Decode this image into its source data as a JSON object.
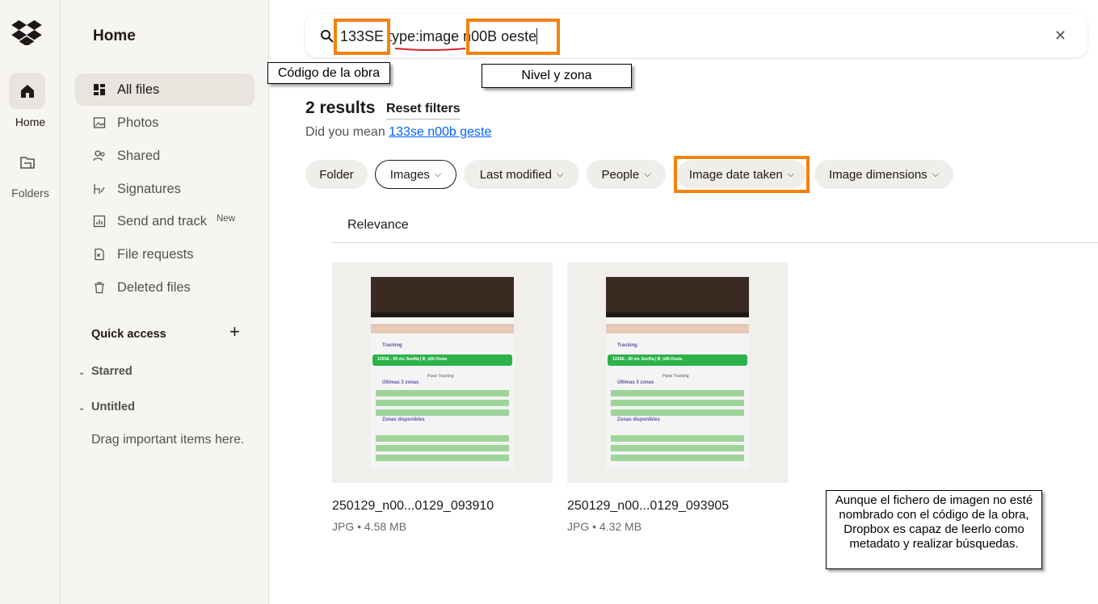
{
  "rail": {
    "home_label": "Home",
    "folders_label": "Folders"
  },
  "nav": {
    "title": "Home",
    "items": [
      {
        "label": "All files",
        "icon": "all-files-icon"
      },
      {
        "label": "Photos",
        "icon": "photos-icon"
      },
      {
        "label": "Shared",
        "icon": "shared-icon"
      },
      {
        "label": "Signatures",
        "icon": "signature-icon"
      },
      {
        "label": "Send and track",
        "icon": "chart-icon",
        "badge": "New"
      },
      {
        "label": "File requests",
        "icon": "file-request-icon"
      },
      {
        "label": "Deleted files",
        "icon": "trash-icon"
      }
    ],
    "quick_access": "Quick access",
    "starred": "Starred",
    "untitled": "Untitled",
    "drag_note": "Drag important items here."
  },
  "search": {
    "query_part1": "133SE ",
    "query_part2": "type:image ",
    "query_part3": "n00B oeste"
  },
  "callouts": {
    "codigo": "Código de la obra",
    "nivel": "Nivel y zona",
    "note": "Aunque el fichero de imagen no esté nombrado con el código de la obra, Dropbox es capaz de leerlo como metadato y realizar búsquedas."
  },
  "results": {
    "count": "2 results",
    "reset": "Reset filters",
    "did_you_mean_prefix": "Did you mean ",
    "did_you_mean_link": "133se n00b geste",
    "sort": "Relevance"
  },
  "filters": [
    "Folder",
    "Images",
    "Last modified",
    "People",
    "Image date taken",
    "Image dimensions"
  ],
  "files": [
    {
      "name": "250129_n00...0129_093910",
      "meta": "JPG • 4.58 MB"
    },
    {
      "name": "250129_n00...0129_093905",
      "meta": "JPG • 4.32 MB"
    }
  ],
  "photo_text": {
    "tracking": "Tracking",
    "green": "133SE - 50 viv. Sevilla | B_n00-Oeste",
    "ultimas": "Últimas 3 zonas",
    "zonas": "Zonas disponibles",
    "parar": "Parar Tracking"
  },
  "colors": {
    "highlight": "#f5820a",
    "link": "#0061fe",
    "sidebar_bg": "#f7f5f2"
  }
}
